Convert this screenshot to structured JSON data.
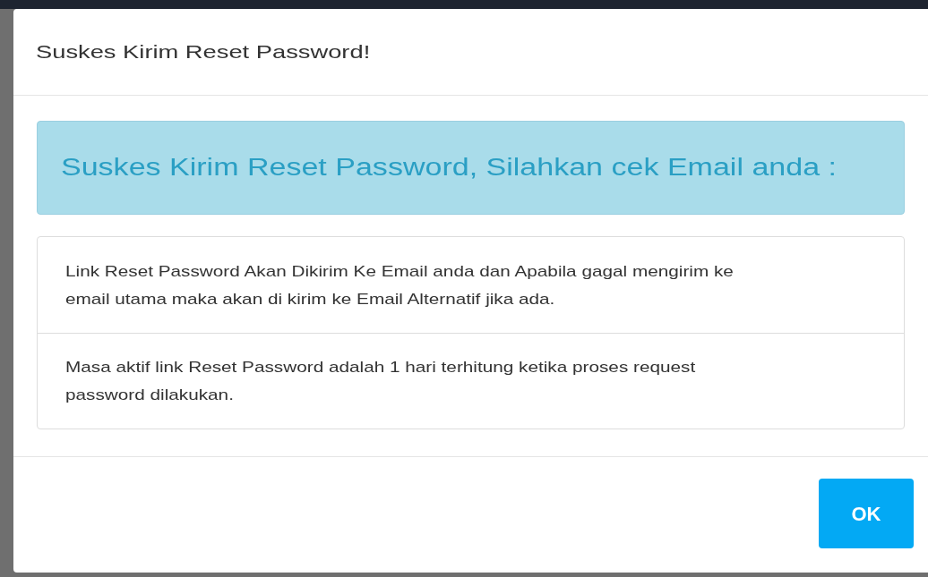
{
  "dialog": {
    "title": "Suskes Kirim Reset Password!"
  },
  "alert": {
    "text": "Suskes Kirim Reset Password, Silahkan cek Email anda :"
  },
  "notes": [
    {
      "lines": [
        "Link Reset Password Akan Dikirim Ke Email anda dan Apabila gagal mengirim ke",
        "email utama maka akan di kirim ke Email Alternatif jika ada."
      ]
    },
    {
      "lines": [
        "Masa aktif link Reset Password adalah 1 hari terhitung ketika proses request",
        "password dilakukan."
      ]
    }
  ],
  "buttons": [
    "OK"
  ]
}
